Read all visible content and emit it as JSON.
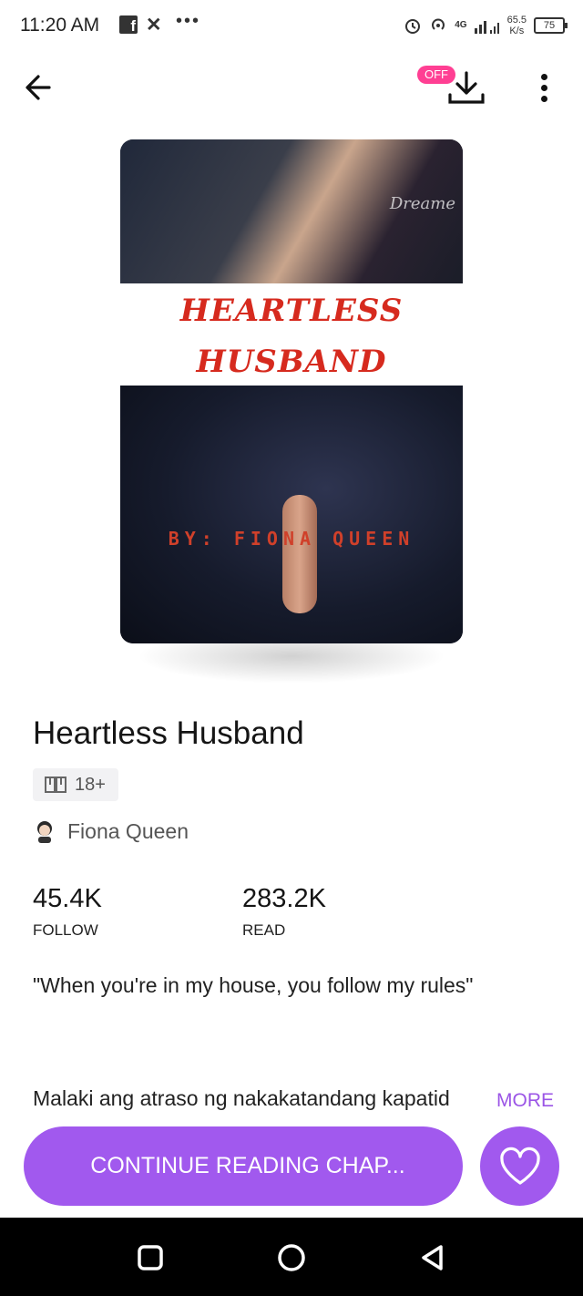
{
  "status_bar": {
    "time": "11:20 AM",
    "icons": [
      "facebook-icon",
      "x-icon",
      "more-dots-icon",
      "alarm-icon",
      "hotspot-icon",
      "signal-icon",
      "battery-icon"
    ],
    "network_label": "4G",
    "speed_value": "65.5",
    "speed_unit": "K/s",
    "battery": "75"
  },
  "header": {
    "offline_badge": "OFF"
  },
  "cover": {
    "brand": "Dreame",
    "title_line1": "HEARTLESS",
    "title_line2": "HUSBAND",
    "author_line": "BY: FIONA QUEEN"
  },
  "book": {
    "title": "Heartless Husband",
    "rating": "18+",
    "author": "Fiona Queen",
    "stats": [
      {
        "value": "45.4K",
        "label": "FOLLOW"
      },
      {
        "value": "283.2K",
        "label": "READ"
      }
    ],
    "tagline": "\"When you're in my house, you follow my rules\"",
    "synopsis": "Malaki ang atraso ng nakakatandang kapatid",
    "more_label": "MORE"
  },
  "actions": {
    "continue_label": "CONTINUE READING CHAP...",
    "accent_color": "#a159ee"
  }
}
